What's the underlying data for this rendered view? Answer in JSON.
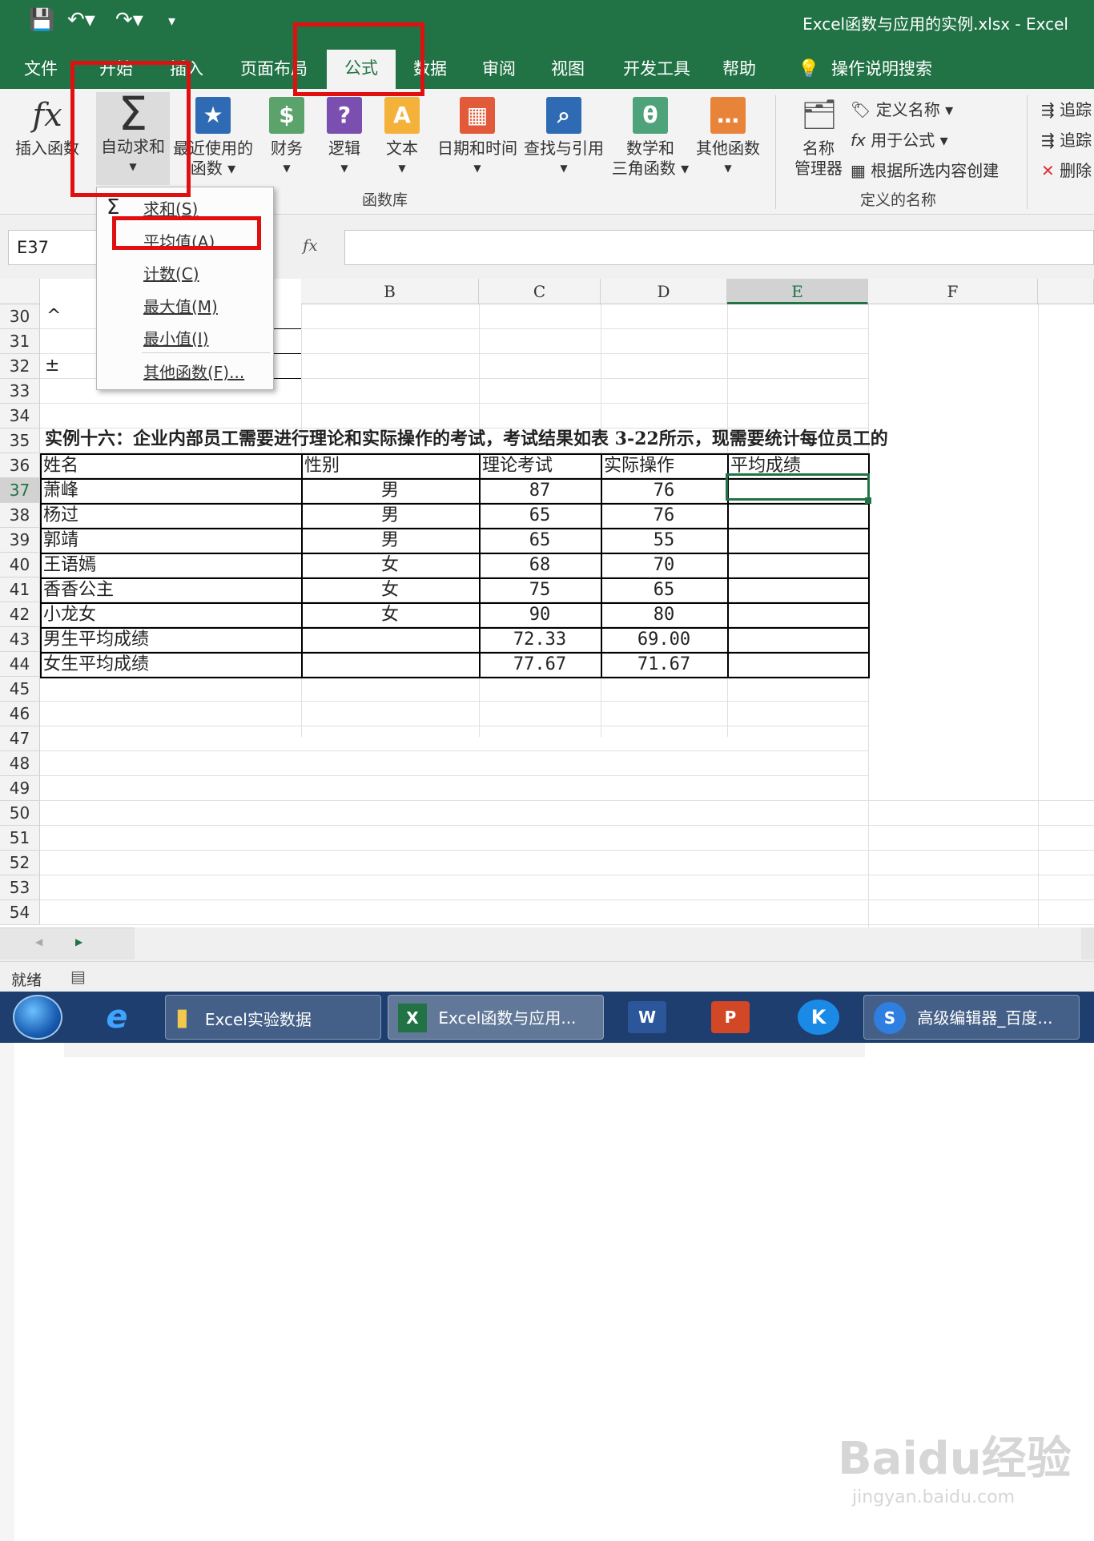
{
  "window": {
    "title": "Excel函数与应用的实例.xlsx  -  Excel"
  },
  "tabs": [
    "文件",
    "开始",
    "插入",
    "页面布局",
    "公式",
    "数据",
    "审阅",
    "视图",
    "开发工具",
    "帮助"
  ],
  "search_label": "操作说明搜索",
  "ribbon": {
    "insert_function": "插入函数",
    "autosum": "自动求和",
    "recent": [
      "最近使用的",
      "函数"
    ],
    "financial": "财务",
    "logical": "逻辑",
    "text": "文本",
    "datetime": "日期和时间",
    "lookup": "查找与引用",
    "math": [
      "数学和",
      "三角函数"
    ],
    "more": "其他函数",
    "group_library": "函数库",
    "name_manager": [
      "名称",
      "管理器"
    ],
    "define_name": "定义名称",
    "use_in_formula": "用于公式",
    "create_from_selection": "根据所选内容创建",
    "group_names": "定义的名称",
    "trace_precedents": "追踪",
    "trace_dependents": "追踪",
    "remove_arrows": "删除"
  },
  "autosum_menu": [
    "求和(S)",
    "平均值(A)",
    "计数(C)",
    "最大值(M)",
    "最小值(I)",
    "其他函数(F)..."
  ],
  "namebox": "E37",
  "columns": [
    "B",
    "C",
    "D",
    "E",
    "F"
  ],
  "rows": [
    "30",
    "31",
    "32",
    "33",
    "34",
    "35",
    "36",
    "37",
    "38",
    "39",
    "40",
    "41",
    "42",
    "43",
    "44",
    "45",
    "46",
    "47",
    "48",
    "49",
    "50",
    "51",
    "52",
    "53",
    "54"
  ],
  "example_title": "实例十六：企业内部员工需要进行理论和实际操作的考试，考试结果如表 3-22所示，现需要统计每位员工的",
  "table": {
    "headers": [
      "姓名",
      "性别",
      "理论考试",
      "实际操作",
      "平均成绩"
    ],
    "rows": [
      [
        "萧峰",
        "男",
        "87",
        "76",
        ""
      ],
      [
        "杨过",
        "男",
        "65",
        "76",
        ""
      ],
      [
        "郭靖",
        "男",
        "65",
        "55",
        ""
      ],
      [
        "王语嫣",
        "女",
        "68",
        "70",
        ""
      ],
      [
        "香香公主",
        "女",
        "75",
        "65",
        ""
      ],
      [
        "小龙女",
        "女",
        "90",
        "80",
        ""
      ],
      [
        "男生平均成绩",
        "",
        "72.33",
        "69.00",
        ""
      ],
      [
        "女生平均成绩",
        "",
        "77.67",
        "71.67",
        ""
      ]
    ]
  },
  "stray_marks": {
    "r30": "^",
    "r32": "±"
  },
  "status": "就绪",
  "taskbar": [
    {
      "label": "Excel实验数据"
    },
    {
      "label": "Excel函数与应用..."
    },
    {
      "label": "高级编辑器_百度..."
    }
  ],
  "watermark": {
    "logo": "Baidu经验",
    "url": "jingyan.baidu.com"
  },
  "colors": {
    "excel_green": "#217346",
    "highlight_red": "#e11010"
  }
}
